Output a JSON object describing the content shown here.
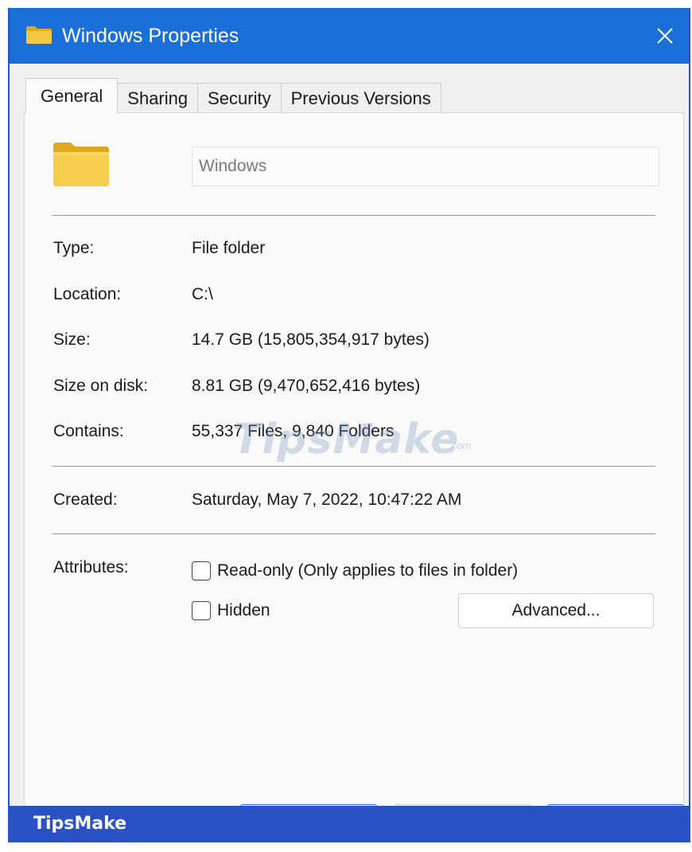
{
  "window": {
    "title": "Windows Properties",
    "icon": "folder-icon",
    "close_icon": "close-icon"
  },
  "tabs": [
    {
      "label": "General",
      "active": true
    },
    {
      "label": "Sharing",
      "active": false
    },
    {
      "label": "Security",
      "active": false
    },
    {
      "label": "Previous Versions",
      "active": false
    }
  ],
  "general": {
    "folder_name": "Windows",
    "properties": {
      "type": {
        "label": "Type:",
        "value": "File folder"
      },
      "location": {
        "label": "Location:",
        "value": "C:\\"
      },
      "size": {
        "label": "Size:",
        "value": "14.7 GB (15,805,354,917 bytes)"
      },
      "size_on_disk": {
        "label": "Size on disk:",
        "value": "8.81 GB (9,470,652,416 bytes)"
      },
      "contains": {
        "label": "Contains:",
        "value": "55,337 Files, 9,840 Folders"
      },
      "created": {
        "label": "Created:",
        "value": "Saturday, May 7, 2022, 10:47:22 AM"
      }
    },
    "attributes": {
      "label": "Attributes:",
      "read_only": {
        "label": "Read-only (Only applies to files in folder)",
        "checked": false
      },
      "hidden": {
        "label": "Hidden",
        "checked": false
      },
      "advanced_button": "Advanced..."
    }
  },
  "watermark": {
    "text": "TipsMake",
    "suffix": ".com"
  },
  "footer": {
    "brand": "TipsMake"
  },
  "colors": {
    "titlebar": "#1a6fd8",
    "footer": "#2b52c4",
    "folder_yellow": "#f5c842",
    "folder_dark": "#e0a81c"
  }
}
